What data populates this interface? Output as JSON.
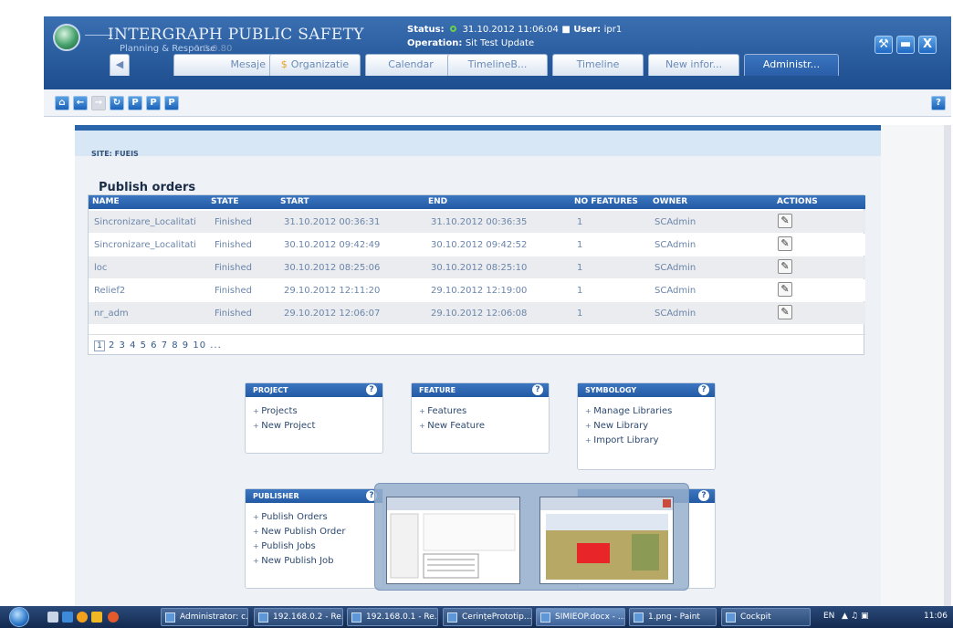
{
  "header": {
    "brand": "INTERGRAPH PUBLIC SAFETY",
    "subtitle": "Planning & Response",
    "version": "1.0.0.80",
    "status_label": "Status:",
    "status_value": "31.10.2012 11:06:04",
    "user_label": "User:",
    "user_value": "ipr1",
    "operation_label": "Operation:",
    "operation_value": "Sit Test Update"
  },
  "tabs": [
    {
      "label": "Mesaje"
    },
    {
      "label": "Organizatie"
    },
    {
      "label": "Calendar"
    },
    {
      "label": "TimelineB..."
    },
    {
      "label": "Timeline"
    },
    {
      "label": "New infor..."
    },
    {
      "label": "Administr..."
    }
  ],
  "site": "SITE: FUEIS",
  "page_title": "Publish orders",
  "table": {
    "columns": [
      "NAME",
      "STATE",
      "START",
      "END",
      "NO FEATURES",
      "OWNER",
      "ACTIONS"
    ],
    "rows": [
      {
        "name": "Sincronizare_Localitati",
        "state": "Finished",
        "start": "31.10.2012 00:36:31",
        "end": "31.10.2012 00:36:35",
        "features": "1",
        "owner": "SCAdmin"
      },
      {
        "name": "Sincronizare_Localitati",
        "state": "Finished",
        "start": "30.10.2012 09:42:49",
        "end": "30.10.2012 09:42:52",
        "features": "1",
        "owner": "SCAdmin"
      },
      {
        "name": "loc",
        "state": "Finished",
        "start": "30.10.2012 08:25:06",
        "end": "30.10.2012 08:25:10",
        "features": "1",
        "owner": "SCAdmin"
      },
      {
        "name": "Relief2",
        "state": "Finished",
        "start": "29.10.2012 12:11:20",
        "end": "29.10.2012 12:19:00",
        "features": "1",
        "owner": "SCAdmin"
      },
      {
        "name": "nr_adm",
        "state": "Finished",
        "start": "29.10.2012 12:06:07",
        "end": "29.10.2012 12:06:08",
        "features": "1",
        "owner": "SCAdmin"
      }
    ],
    "pager_current": "1",
    "pager_rest": "2 3 4 5 6 7 8 9 10 ..."
  },
  "boxes": {
    "project": {
      "title": "PROJECT",
      "items": [
        "Projects",
        "New Project"
      ]
    },
    "feature": {
      "title": "FEATURE",
      "items": [
        "Features",
        "New Feature"
      ]
    },
    "symbology": {
      "title": "SYMBOLOGY",
      "items": [
        "Manage Libraries",
        "New Library",
        "Import Library"
      ]
    },
    "publisher": {
      "title": "PUBLISHER",
      "items": [
        "Publish Orders",
        "New Publish Order",
        "Publish Jobs",
        "New Publish Job"
      ]
    }
  },
  "taskbar": {
    "items": [
      "Administrator: c...",
      "192.168.0.2 - Re...",
      "192.168.0.1 - Re...",
      "CerințePrototip...",
      "SIMIEOP.docx - ...",
      "1.png - Paint",
      "Cockpit"
    ],
    "lang": "EN",
    "clock": "11:06"
  },
  "colors": {
    "accent": "#2a64aa",
    "header": "#1d4e8f",
    "status_dot": "#6ecf4b"
  }
}
